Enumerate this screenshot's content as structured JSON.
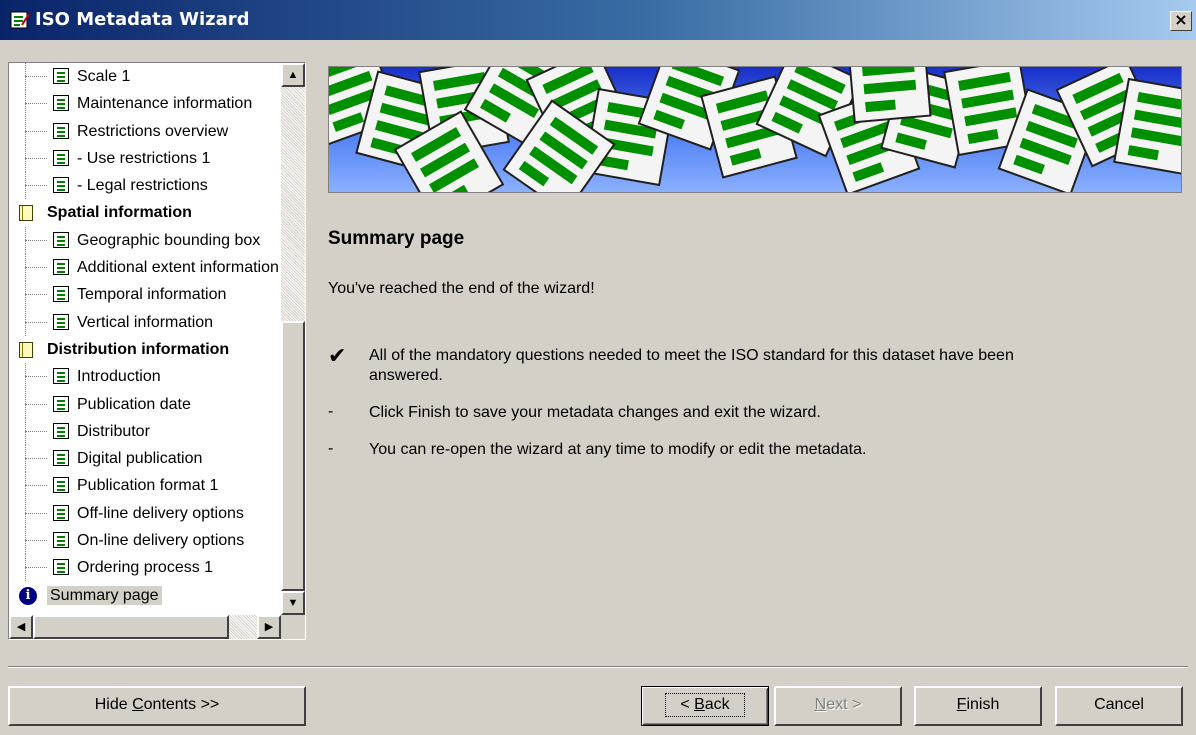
{
  "window": {
    "title": "ISO Metadata Wizard",
    "close_symbol": "×"
  },
  "tree": {
    "items": [
      {
        "label": "Scale 1",
        "type": "child"
      },
      {
        "label": "Maintenance information",
        "type": "child"
      },
      {
        "label": "Restrictions overview",
        "type": "child"
      },
      {
        "label": "- Use restrictions 1",
        "type": "child"
      },
      {
        "label": "- Legal restrictions",
        "type": "child"
      },
      {
        "label": "Spatial information",
        "type": "section"
      },
      {
        "label": "Geographic bounding box",
        "type": "child"
      },
      {
        "label": "Additional extent information",
        "type": "child"
      },
      {
        "label": "Temporal information",
        "type": "child"
      },
      {
        "label": "Vertical information",
        "type": "child"
      },
      {
        "label": "Distribution information",
        "type": "section"
      },
      {
        "label": "Introduction",
        "type": "child"
      },
      {
        "label": "Publication date",
        "type": "child"
      },
      {
        "label": "Distributor",
        "type": "child"
      },
      {
        "label": "Digital publication",
        "type": "child"
      },
      {
        "label": "Publication format 1",
        "type": "child"
      },
      {
        "label": "Off-line delivery options",
        "type": "child"
      },
      {
        "label": "On-line delivery options",
        "type": "child"
      },
      {
        "label": "Ordering process 1",
        "type": "child"
      },
      {
        "label": "Summary page",
        "type": "selected"
      }
    ]
  },
  "main": {
    "heading": "Summary page",
    "end_message": "You've reached the end of the wizard!",
    "bullets": [
      {
        "mark": "✔",
        "text": "All of the mandatory questions needed to meet the ISO standard for this dataset have been answered."
      },
      {
        "mark": "-",
        "text": "Click Finish to save your metadata changes and exit the wizard."
      },
      {
        "mark": "-",
        "text": "You can re-open the wizard at any time to modify or edit the metadata."
      }
    ]
  },
  "buttons": {
    "hide_contents": {
      "pre": "Hide ",
      "key": "C",
      "post": "ontents >>"
    },
    "back": {
      "pre": "< ",
      "key": "B",
      "post": "ack"
    },
    "next": {
      "pre": "",
      "key": "N",
      "post": "ext >"
    },
    "finish": {
      "pre": "",
      "key": "F",
      "post": "inish"
    },
    "cancel": "Cancel"
  },
  "colors": {
    "title_bar_start": "#0a246a",
    "dialog_bg": "#d4d0c8",
    "banner_blue": "#4d7cf4",
    "doc_icon_green": "#008000"
  }
}
